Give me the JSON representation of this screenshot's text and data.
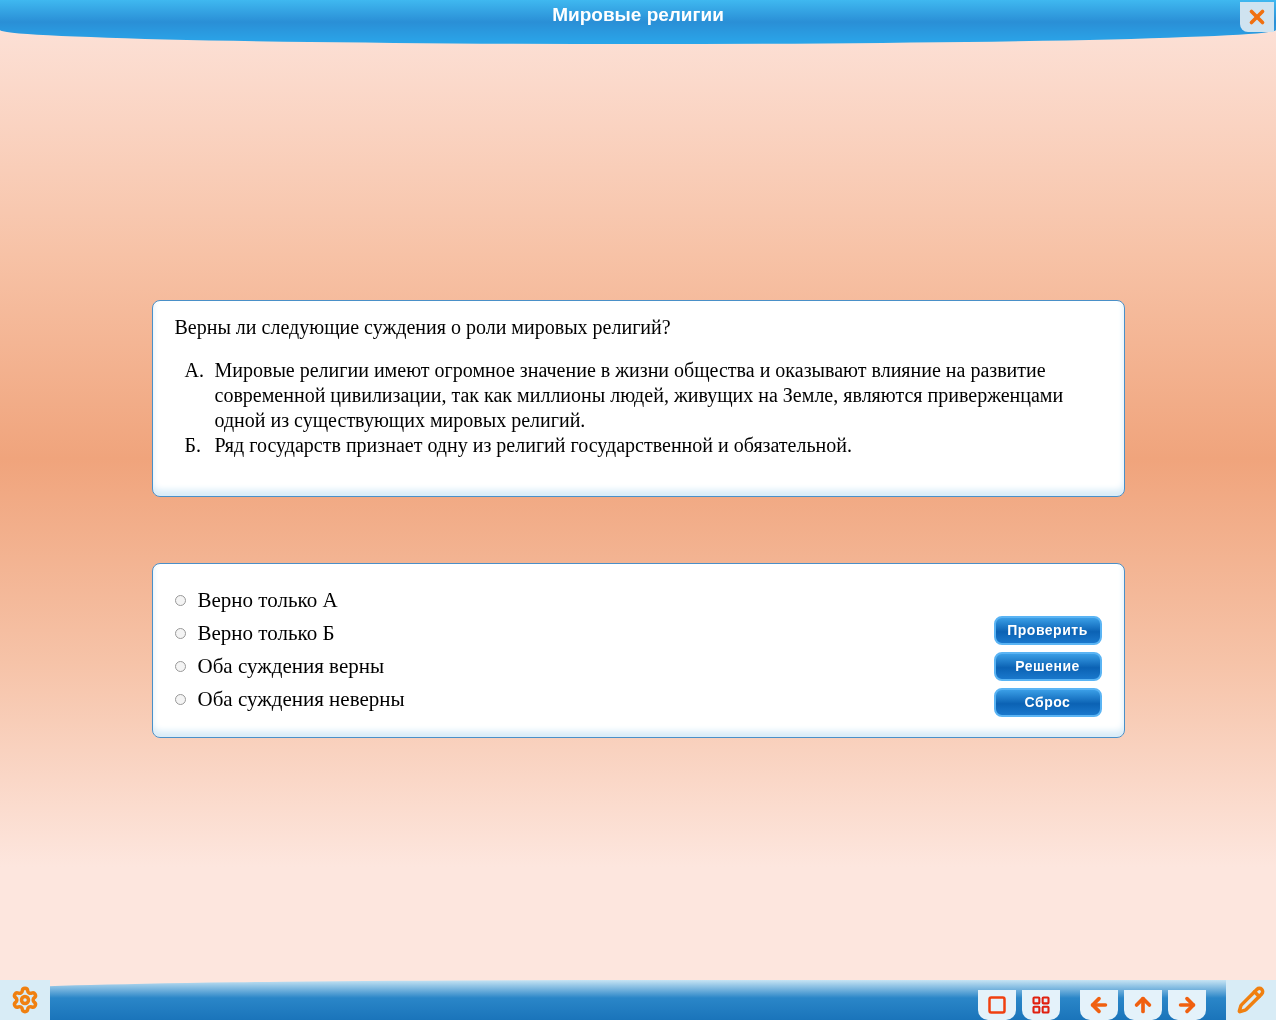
{
  "window": {
    "title": "Мировые религии"
  },
  "question": {
    "prompt": "Верны ли следующие суждения о роли мировых религий?",
    "statements": [
      {
        "marker": "А.",
        "text": "Мировые религии имеют огромное значение в жизни общества и оказывают влияние на развитие современной цивилизации, так как миллионы людей, живущих на Земле, являются приверженцами одной из существующих мировых религий."
      },
      {
        "marker": "Б.",
        "text": "Ряд государств признает одну из религий государственной и обязательной."
      }
    ]
  },
  "options": [
    {
      "label": "Верно только А",
      "selected": false
    },
    {
      "label": "Верно только Б",
      "selected": false
    },
    {
      "label": "Оба суждения верны",
      "selected": false
    },
    {
      "label": "Оба суждения неверны",
      "selected": false
    }
  ],
  "buttons": [
    "Проверить",
    "Решение",
    "Сброс"
  ]
}
